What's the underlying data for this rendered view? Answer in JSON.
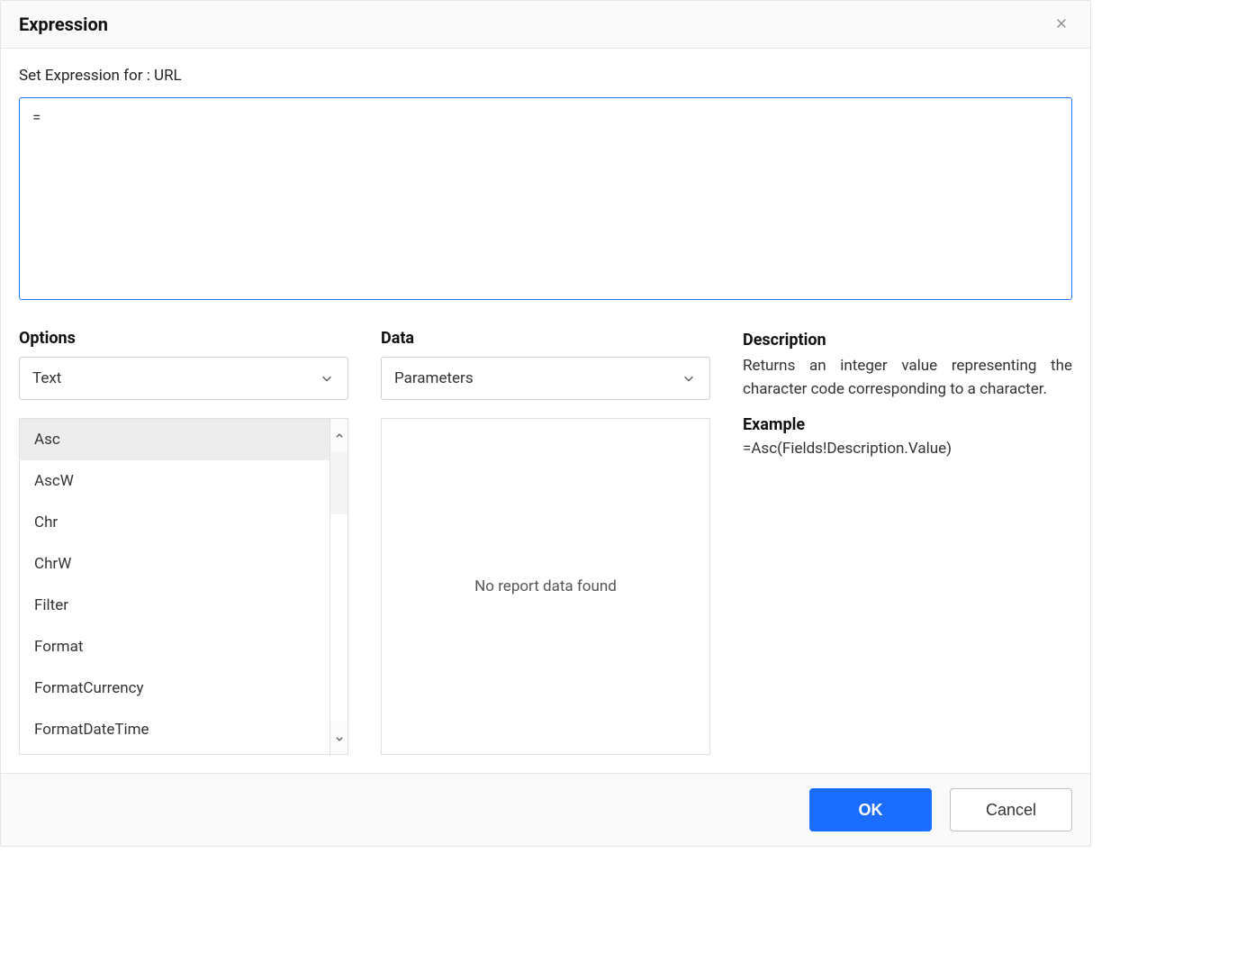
{
  "dialog": {
    "title": "Expression",
    "subtitle": "Set Expression for : URL"
  },
  "expression": {
    "value": "="
  },
  "options": {
    "label": "Options",
    "selected": "Text",
    "items": [
      "Asc",
      "AscW",
      "Chr",
      "ChrW",
      "Filter",
      "Format",
      "FormatCurrency",
      "FormatDateTime"
    ],
    "selected_index": 0
  },
  "data": {
    "label": "Data",
    "selected": "Parameters",
    "empty_message": "No report data found"
  },
  "description": {
    "title": "Description",
    "text": "Returns an integer value representing the character code corresponding to a character.",
    "example_title": "Example",
    "example_text": "=Asc(Fields!Description.Value)"
  },
  "footer": {
    "ok": "OK",
    "cancel": "Cancel"
  }
}
